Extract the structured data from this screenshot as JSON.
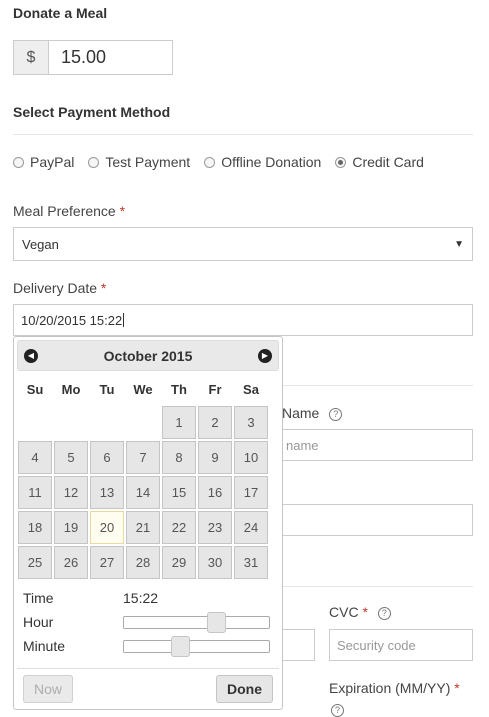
{
  "donate": {
    "heading": "Donate a Meal",
    "currency": "$",
    "amount": "15.00"
  },
  "payment": {
    "heading": "Select Payment Method",
    "options": [
      {
        "label": "PayPal",
        "checked": false
      },
      {
        "label": "Test Payment",
        "checked": false
      },
      {
        "label": "Offline Donation",
        "checked": false
      },
      {
        "label": "Credit Card",
        "checked": true
      }
    ]
  },
  "meal": {
    "label": "Meal Preference",
    "required": "*",
    "value": "Vegan"
  },
  "delivery": {
    "label": "Delivery Date",
    "required": "*",
    "value": "10/20/2015 15:22"
  },
  "card": {
    "name_label": "Name",
    "name_placeholder": "name",
    "cvc_label": "CVC",
    "cvc_required": "*",
    "cvc_placeholder": "Security code",
    "expiration_label": "Expiration (MM/YY)",
    "expiration_required": "*",
    "info_icon": "?"
  },
  "datepicker": {
    "title": "October 2015",
    "prev_icon": "prev-arrow-icon",
    "next_icon": "next-arrow-icon",
    "weekdays": [
      "Su",
      "Mo",
      "Tu",
      "We",
      "Th",
      "Fr",
      "Sa"
    ],
    "leading_blanks": 4,
    "days": [
      "1",
      "2",
      "3",
      "4",
      "5",
      "6",
      "7",
      "8",
      "9",
      "10",
      "11",
      "12",
      "13",
      "14",
      "15",
      "16",
      "17",
      "18",
      "19",
      "20",
      "21",
      "22",
      "23",
      "24",
      "25",
      "26",
      "27",
      "28",
      "29",
      "30",
      "31"
    ],
    "today": "20",
    "time_label": "Time",
    "time_value": "15:22",
    "hour_label": "Hour",
    "minute_label": "Minute",
    "hour_fraction": 0.65,
    "minute_fraction": 0.37,
    "now_label": "Now",
    "done_label": "Done"
  }
}
